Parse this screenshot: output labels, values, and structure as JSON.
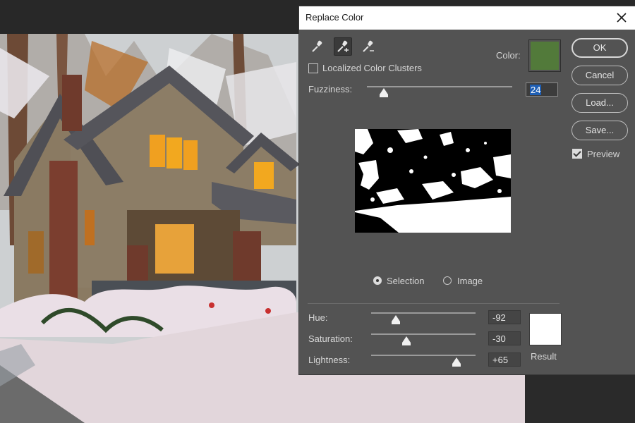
{
  "dialog": {
    "title": "Replace Color",
    "color_label": "Color:",
    "selected_color": "#527a3a",
    "localized_clusters_label": "Localized Color Clusters",
    "localized_clusters_checked": false,
    "fuzziness_label": "Fuzziness:",
    "fuzziness_value": "24",
    "fuzziness_slider": 24,
    "view_mode": {
      "options": [
        "Selection",
        "Image"
      ],
      "selected": "Selection"
    },
    "hue_label": "Hue:",
    "hue_value": "-92",
    "saturation_label": "Saturation:",
    "saturation_value": "-30",
    "lightness_label": "Lightness:",
    "lightness_value": "+65",
    "result_label": "Result",
    "result_color": "#ffffff",
    "buttons": {
      "ok": "OK",
      "cancel": "Cancel",
      "load": "Load...",
      "save": "Save..."
    },
    "preview_label": "Preview",
    "preview_checked": true,
    "tools": [
      "eyedropper-icon",
      "eyedropper-plus-icon",
      "eyedropper-minus-icon"
    ],
    "close_icon": "close-icon"
  }
}
